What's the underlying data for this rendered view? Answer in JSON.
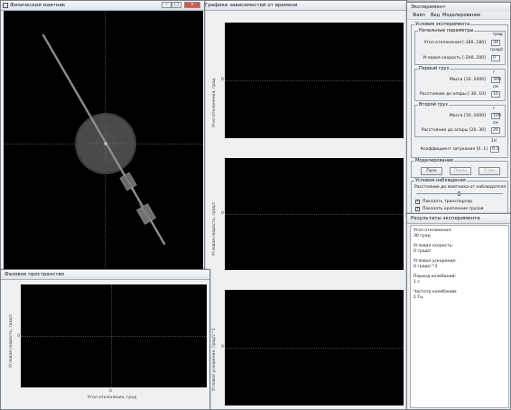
{
  "pendulum_window": {
    "title": "Физический маятник"
  },
  "graphs_window": {
    "title": "Графики зависимостей от времени",
    "graph1": {
      "ylabel": "Угол отклонения, град",
      "zero": "0"
    },
    "graph2": {
      "ylabel": "Угловая скорость, град/с",
      "zero": "0"
    },
    "graph3": {
      "ylabel": "Угловое ускорение, град/с^2",
      "zero": "0"
    }
  },
  "phase_window": {
    "title": "Фазовое пространство",
    "ylabel": "Угловая скорость, град/с",
    "xlabel": "Угол отклонения, град",
    "x_zero": "0",
    "y_zero": "0"
  },
  "experiment_window": {
    "title": "Эксперимент",
    "menu": [
      "Файл",
      "Вид",
      "Моделирование"
    ],
    "conditions_group": "Условия эксперимента",
    "initial_params_group": "Начальные параметры",
    "angle_label": "Угол отклонения [-180..180]",
    "angle_unit": "град",
    "angle_value": "30",
    "velocity_label": "Угловая скорость [-200..200]",
    "velocity_unit": "град/с",
    "velocity_value": "0",
    "load1_group": "Первый груз",
    "load1_mass_label": "Масса [10..1000]",
    "load1_mass_unit": "г",
    "load1_mass_value": "300",
    "load1_dist_label": "Расстояние до опоры [-30..10]",
    "load1_dist_unit": "см",
    "load1_dist_value": "10",
    "load2_group": "Второй груз",
    "load2_mass_label": "Масса [10..1000]",
    "load2_mass_unit": "г",
    "load2_mass_value": "100",
    "load2_dist_label": "Расстояние до опоры [20..30]",
    "load2_dist_unit": "см",
    "load2_dist_value": "20",
    "damping_label": "Коэффициент затухания [0..1]",
    "damping_unit": "1/с",
    "damping_value": "0.3",
    "modeling_group": "Моделирование",
    "start_label": "Пуск",
    "pause_label": "Пауза",
    "stop_label": "Стоп",
    "observation_group": "Условия наблюдения",
    "observer_distance_label": "Расстояние до маятника от наблюдателя",
    "show_protractor_label": "Показать транспортир",
    "show_fastening_label": "Показать крепление грузов"
  },
  "results_window": {
    "title": "Результаты эксперимента",
    "angle_label": "Угол отклонения:",
    "angle_value": "30 град",
    "velocity_label": "Угловая скорость:",
    "velocity_value": "0 град/с",
    "acceleration_label": "Угловое ускорение:",
    "acceleration_value": "0 град/с^2",
    "period_label": "Период колебаний:",
    "period_value": "1 с",
    "frequency_label": "Частота колебаний:",
    "frequency_value": "1 Гц"
  }
}
